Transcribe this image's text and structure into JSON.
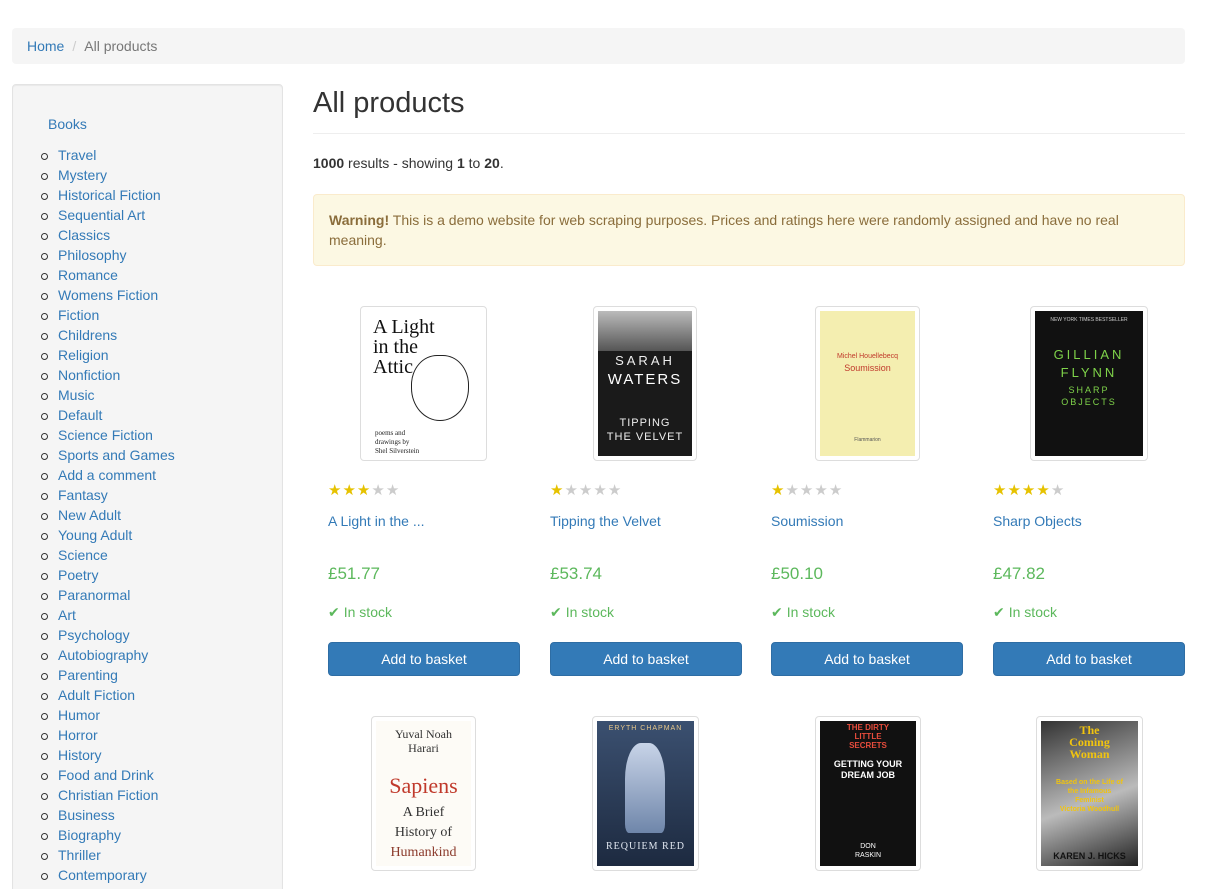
{
  "breadcrumb": {
    "home": "Home",
    "separator": "/",
    "current": "All products"
  },
  "sidebar": {
    "root": "Books",
    "categories": [
      "Travel",
      "Mystery",
      "Historical Fiction",
      "Sequential Art",
      "Classics",
      "Philosophy",
      "Romance",
      "Womens Fiction",
      "Fiction",
      "Childrens",
      "Religion",
      "Nonfiction",
      "Music",
      "Default",
      "Science Fiction",
      "Sports and Games",
      "Add a comment",
      "Fantasy",
      "New Adult",
      "Young Adult",
      "Science",
      "Poetry",
      "Paranormal",
      "Art",
      "Psychology",
      "Autobiography",
      "Parenting",
      "Adult Fiction",
      "Humor",
      "Horror",
      "History",
      "Food and Drink",
      "Christian Fiction",
      "Business",
      "Biography",
      "Thriller",
      "Contemporary"
    ]
  },
  "header": {
    "title": "All products"
  },
  "results": {
    "total": "1000",
    "text1": " results - showing ",
    "from": "1",
    "text2": " to ",
    "to": "20",
    "text3": "."
  },
  "alert": {
    "label": "Warning!",
    "text": " This is a demo website for web scraping purposes. Prices and ratings here were randomly assigned and have no real meaning."
  },
  "products": [
    {
      "title": "A Light in the ...",
      "price": "£51.77",
      "rating": 3,
      "stock": "In stock",
      "button": "Add to basket",
      "cover": {
        "lines": [
          "A Light",
          "in the",
          "Attic"
        ],
        "sub": [
          "poems and",
          "drawings by",
          "Shel Silverstein"
        ]
      }
    },
    {
      "title": "Tipping the Velvet",
      "price": "£53.74",
      "rating": 1,
      "stock": "In stock",
      "button": "Add to basket",
      "cover": {
        "lines": [
          "SARAH",
          "WATERS"
        ],
        "sub": [
          "TIPPING",
          "THE VELVET"
        ]
      }
    },
    {
      "title": "Soumission",
      "price": "£50.10",
      "rating": 1,
      "stock": "In stock",
      "button": "Add to basket",
      "cover": {
        "lines": [
          "Michel Houellebecq",
          "Soumission"
        ],
        "sub": [
          "Flammarion"
        ]
      }
    },
    {
      "title": "Sharp Objects",
      "price": "£47.82",
      "rating": 4,
      "stock": "In stock",
      "button": "Add to basket",
      "cover": {
        "lines": [
          "NEW YORK TIMES BESTSELLER",
          "GILLIAN",
          "FLYNN"
        ],
        "sub": [
          "SHARP",
          "OBJECTS"
        ]
      }
    },
    {
      "cover": {
        "lines": [
          "Yuval Noah",
          "Harari"
        ],
        "big": "Sapiens",
        "sub": [
          "A Brief",
          "History of",
          "Humankind"
        ]
      }
    },
    {
      "cover": {
        "lines": [
          "ERYTH CHAPMAN"
        ],
        "sub": [
          "REQUIEM RED"
        ]
      }
    },
    {
      "cover": {
        "lines": [
          "THE DIRTY",
          "LITTLE",
          "SECRETS"
        ],
        "mid": [
          "GETTING YOUR",
          "DREAM JOB"
        ],
        "sub": [
          "DON",
          "RASKIN"
        ]
      }
    },
    {
      "cover": {
        "lines": [
          "The",
          "Coming",
          "Woman"
        ],
        "mid": [
          "Based on the Life of",
          "the Infamous",
          "Feminist",
          "Victoria Woodhull"
        ],
        "sub": [
          "KAREN J. HICKS"
        ]
      }
    }
  ],
  "colors": {
    "link": "#337ab7",
    "price": "#5cb85c",
    "star_on": "#e6c200",
    "star_off": "#cccccc",
    "button": "#337ab7"
  }
}
